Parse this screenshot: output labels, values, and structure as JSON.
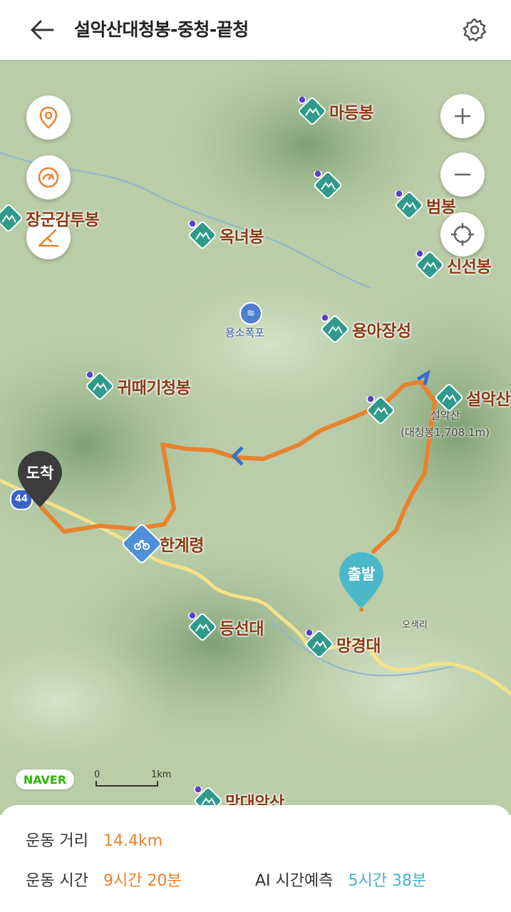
{
  "header": {
    "title": "설악산대청봉-중청-끝청"
  },
  "map": {
    "peaks": [
      {
        "name": "마등봉"
      },
      {
        "name": ""
      },
      {
        "name": "범봉"
      },
      {
        "name": "장군감투봉"
      },
      {
        "name": "옥녀봉"
      },
      {
        "name": "신선봉"
      },
      {
        "name": "용아장성"
      },
      {
        "name": "귀때기청봉"
      },
      {
        "name": "설악산"
      },
      {
        "name": ""
      },
      {
        "name": "등선대"
      },
      {
        "name": "망경대"
      },
      {
        "name": "망대암산"
      }
    ],
    "pass_label": "한계령",
    "waterfall_label": "용소폭포",
    "summit_label_1": "설악산",
    "summit_label_2": "(대청봉1,708.1m)",
    "village_label": "오색리",
    "road_badge": "44",
    "arrival_pin": "도착",
    "departure_pin": "출발",
    "attribution": "NAVER",
    "scale_zero": "0",
    "scale_one": "1km",
    "colors": {
      "route": "#e8822d",
      "peak_icon": "#2f9a8c",
      "label": "#8b3a14",
      "road": "#f3e28a"
    }
  },
  "stats": {
    "distance_label": "운동 거리",
    "distance_value": "14.4km",
    "time_label": "운동 시간",
    "time_value": "9시간 20분",
    "ai_label": "AI 시간예측",
    "ai_value": "5시간 38분"
  }
}
